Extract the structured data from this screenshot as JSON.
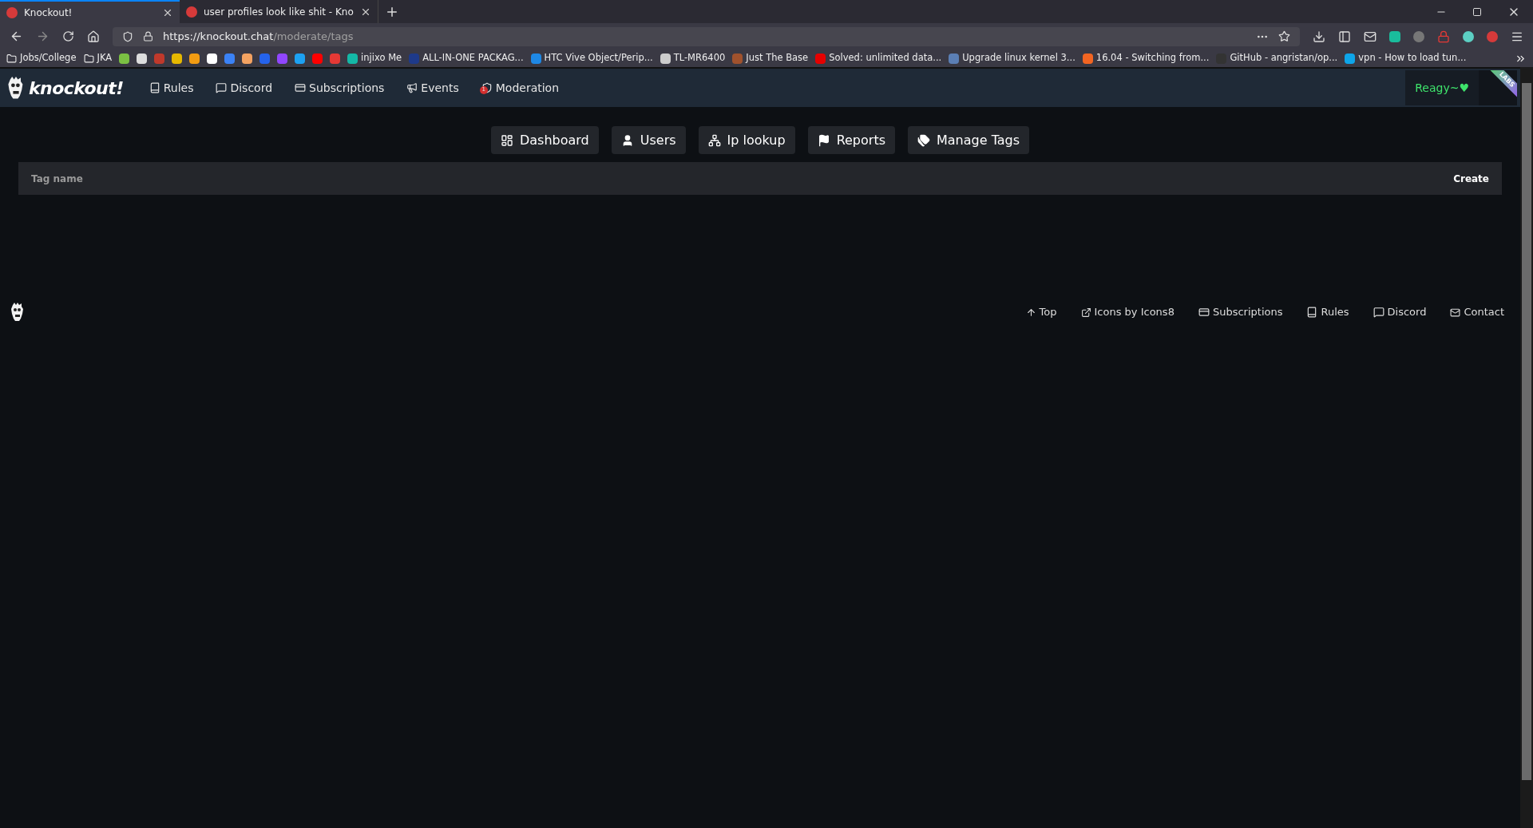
{
  "browser": {
    "tabs": [
      {
        "title": "Knockout!",
        "selected": true
      },
      {
        "title": "user profiles look like shit - Kno",
        "selected": false
      }
    ],
    "url": {
      "host": "https://knockout.chat",
      "path": "/moderate/tags"
    },
    "bookmarks": [
      {
        "kind": "folder",
        "label": "Jobs/College"
      },
      {
        "kind": "folder",
        "label": "JKA"
      },
      {
        "kind": "site",
        "color": "#7bc043"
      },
      {
        "kind": "site",
        "color": "#dddddd"
      },
      {
        "kind": "site",
        "color": "#c0392b"
      },
      {
        "kind": "site",
        "color": "#e6b800"
      },
      {
        "kind": "site",
        "color": "#f39c12"
      },
      {
        "kind": "site",
        "color": "#ffffff"
      },
      {
        "kind": "site",
        "color": "#3b82f6"
      },
      {
        "kind": "site",
        "color": "#f4a261"
      },
      {
        "kind": "site",
        "color": "#2563eb"
      },
      {
        "kind": "site",
        "color": "#9146ff"
      },
      {
        "kind": "site",
        "color": "#1da1f2"
      },
      {
        "kind": "site",
        "color": "#ff0000"
      },
      {
        "kind": "site",
        "color": "#e53935"
      },
      {
        "kind": "site",
        "color": "#14b8a6",
        "label": "injixo Me"
      },
      {
        "kind": "site",
        "color": "#1e3a8a",
        "label": "ALL-IN-ONE PACKAG..."
      },
      {
        "kind": "site",
        "color": "#1e88e5",
        "label": "HTC Vive Object/Perip..."
      },
      {
        "kind": "site",
        "color": "#cccccc",
        "label": "TL-MR6400"
      },
      {
        "kind": "site",
        "color": "#a0522d",
        "label": "Just The Base"
      },
      {
        "kind": "site",
        "color": "#e60000",
        "label": "Solved: unlimited data..."
      },
      {
        "kind": "site",
        "color": "#5b7fb5",
        "label": "Upgrade linux kernel 3..."
      },
      {
        "kind": "site",
        "color": "#f26522",
        "label": "16.04 - Switching from..."
      },
      {
        "kind": "site",
        "color": "#333333",
        "label": "GitHub - angristan/op..."
      },
      {
        "kind": "site",
        "color": "#0ea5e9",
        "label": "vpn - How to load tun..."
      }
    ]
  },
  "site": {
    "logo": "knockout!",
    "nav": [
      {
        "label": "Rules",
        "kind": "rules"
      },
      {
        "label": "Discord",
        "kind": "discord"
      },
      {
        "label": "Subscriptions",
        "kind": "subscriptions"
      },
      {
        "label": "Events",
        "kind": "events"
      },
      {
        "label": "Moderation",
        "kind": "moderation",
        "badge": "1"
      }
    ],
    "user": "Reagy~♥",
    "ribbon": "LABS",
    "mod_tabs": [
      {
        "label": "Dashboard",
        "kind": "dashboard"
      },
      {
        "label": "Users",
        "kind": "users"
      },
      {
        "label": "Ip lookup",
        "kind": "ip"
      },
      {
        "label": "Reports",
        "kind": "reports"
      },
      {
        "label": "Manage Tags",
        "kind": "tags"
      }
    ],
    "tag_form": {
      "placeholder": "Tag name",
      "button": "Create"
    },
    "footer": [
      {
        "label": "Top",
        "kind": "top"
      },
      {
        "label": "Icons by Icons8",
        "kind": "external"
      },
      {
        "label": "Subscriptions",
        "kind": "subscriptions"
      },
      {
        "label": "Rules",
        "kind": "rules"
      },
      {
        "label": "Discord",
        "kind": "discord"
      },
      {
        "label": "Contact",
        "kind": "contact"
      }
    ]
  }
}
